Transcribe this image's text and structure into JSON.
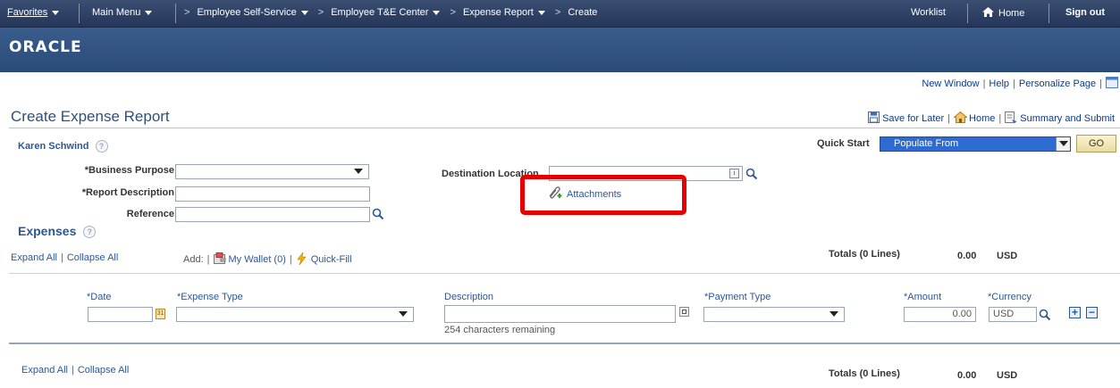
{
  "nav": {
    "favorites": "Favorites",
    "main_menu": "Main Menu",
    "breadcrumbs": [
      "Employee Self-Service",
      "Employee T&E Center",
      "Expense Report",
      "Create"
    ],
    "worklist": "Worklist",
    "home": "Home",
    "signout": "Sign out"
  },
  "banner": {
    "logo": "ORACLE"
  },
  "page_links": {
    "new_window": "New Window",
    "help": "Help",
    "personalize": "Personalize Page"
  },
  "page": {
    "title": "Create Expense Report",
    "save_for_later": "Save for Later",
    "home": "Home",
    "summary_submit": "Summary and Submit"
  },
  "employee": {
    "name": "Karen Schwind"
  },
  "quick_start": {
    "label": "Quick Start",
    "selected": "Populate From",
    "go": "GO"
  },
  "header_fields": {
    "business_purpose": "*Business Purpose",
    "report_description": "*Report Description",
    "reference": "Reference",
    "destination_location": "Destination Location",
    "attachments": "Attachments"
  },
  "expenses": {
    "title": "Expenses",
    "expand_all": "Expand All",
    "collapse_all": "Collapse All",
    "add_label": "Add:",
    "my_wallet": "My Wallet (0)",
    "quick_fill": "Quick-Fill",
    "totals_label": "Totals (0 Lines)",
    "totals_amount": "0.00",
    "totals_currency": "USD"
  },
  "line": {
    "date_label": "*Date",
    "expense_type_label": "*Expense Type",
    "description_label": "Description",
    "payment_type_label": "*Payment Type",
    "amount_label": "*Amount",
    "currency_label": "*Currency",
    "amount_value": "0.00",
    "currency_value": "USD",
    "chars_remaining": "254 characters remaining"
  },
  "colors": {
    "nav_bg": "#2e4166",
    "banner_bg": "#2f5080",
    "link": "#2c5797",
    "highlight": "#e60000",
    "quickstart_bg": "#2e6bd0"
  }
}
